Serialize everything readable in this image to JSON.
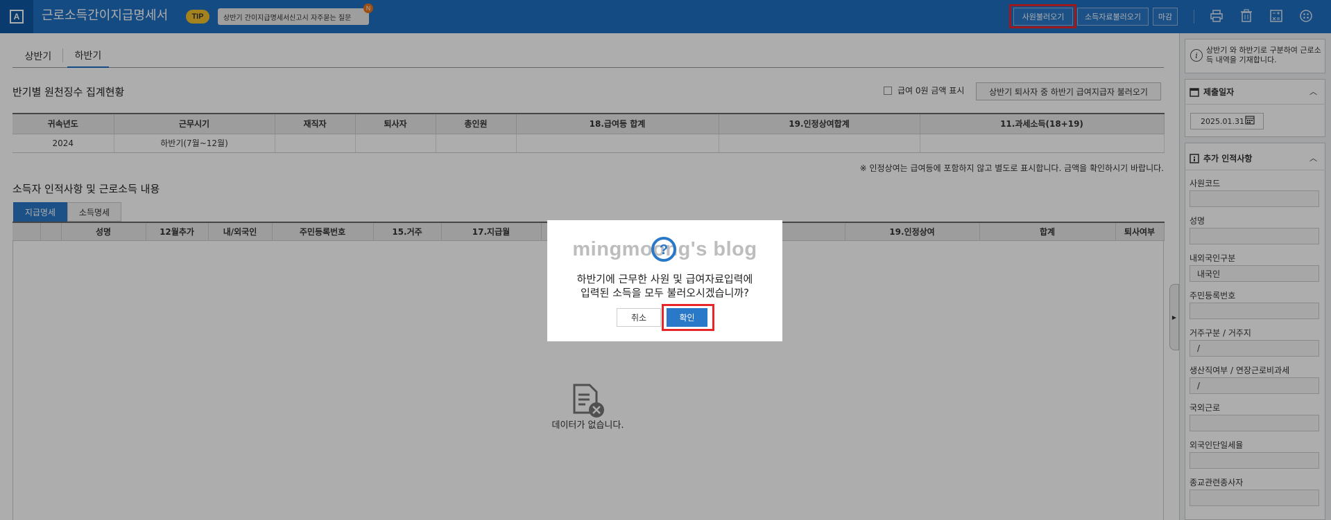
{
  "header": {
    "logo_letter": "A",
    "title": "근로소득간이지급명세서",
    "tip_label": "TIP",
    "faq_text": "상반기 간이지급명세서신고시 자주묻는 질문",
    "new_badge": "N",
    "buttons": {
      "load_employees": "사원불러오기",
      "load_income": "소득자료불러오기",
      "close": "마감"
    },
    "icons": [
      "print-icon",
      "trash-icon",
      "calculator-icon",
      "settings-icon"
    ]
  },
  "tabs": [
    "상반기",
    "하반기"
  ],
  "summary": {
    "title": "반기별 원천징수 집계현황",
    "zero_checkbox_label": "급여 0원 금액 표시",
    "load_retired_button": "상반기 퇴사자 중 하반기 급여지급자 불러오기",
    "columns": [
      "귀속년도",
      "근무시기",
      "재직자",
      "퇴사자",
      "총인원",
      "18.급여등 합계",
      "19.인정상여합계",
      "11.과세소득(18+19)"
    ],
    "rows": [
      [
        "2024",
        "하반기(7월~12월)",
        "",
        "",
        "",
        "",
        "",
        ""
      ]
    ],
    "note": "※ 인정상여는 급여등에 포함하지 않고 별도로 표시합니다. 금액을 확인하시기 바랍니다."
  },
  "detail": {
    "title": "소득자 인적사항 및 근로소득 내용",
    "subtabs": [
      "지급명세",
      "소득명세"
    ],
    "columns": [
      "",
      "",
      "성명",
      "12월추가",
      "내/외국인",
      "주민등록번호",
      "15.거주",
      "17.지급월",
      "",
      "",
      "19.인정상여",
      "합계",
      "퇴사여부"
    ],
    "empty_text": "데이터가 없습니다."
  },
  "right_panel": {
    "info_text": "상반기 와 하반기로 구분하여 근로소득 내역을 기재합니다.",
    "submit_date_title": "제출일자",
    "submit_date": "2025.01.31",
    "person_title": "추가 인적사항",
    "fields": [
      {
        "label": "사원코드",
        "value": ""
      },
      {
        "label": "성명",
        "value": ""
      },
      {
        "label": "내외국인구분",
        "value": "내국인"
      },
      {
        "label": "주민등록번호",
        "value": ""
      },
      {
        "label": "거주구분 / 거주지",
        "value": "/"
      },
      {
        "label": "생산직여부 / 연장근로비과세",
        "value": "/"
      },
      {
        "label": "국외근로",
        "value": ""
      },
      {
        "label": "외국인단일세율",
        "value": ""
      },
      {
        "label": "종교관련종사자",
        "value": ""
      }
    ]
  },
  "dialog": {
    "watermark": "mingmoong's blog",
    "message_line1": "하반기에 근무한 사원 및 급여자료입력에",
    "message_line2": "입력된 소득을 모두 불러오시겠습니까?",
    "cancel": "취소",
    "confirm": "확인"
  },
  "colors": {
    "header_blue": "#1f6fc1",
    "accent_blue": "#2a78c8",
    "highlight_red": "#e8262a",
    "tip_yellow": "#f2c12e"
  }
}
